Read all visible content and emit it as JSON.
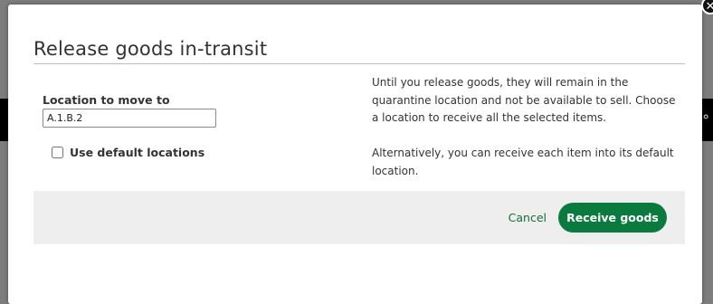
{
  "dialog": {
    "title": "Release goods in-transit",
    "close_icon": "close-icon",
    "location_field": {
      "label": "Location to move to",
      "value": "A.1.B.2"
    },
    "use_default_locations": {
      "label": "Use default locations",
      "checked": false
    },
    "info": {
      "paragraph_1": "Until you release goods, they will remain in the quarantine location and not be available to sell. Choose a location to receive all the selected items.",
      "paragraph_2": "Alternatively, you can receive each item into its default location."
    },
    "footer": {
      "cancel_label": "Cancel",
      "primary_label": "Receive goods"
    },
    "colors": {
      "primary": "#0b7a3e",
      "link": "#1a6b3c",
      "footer_bg": "#eeeeee"
    }
  }
}
